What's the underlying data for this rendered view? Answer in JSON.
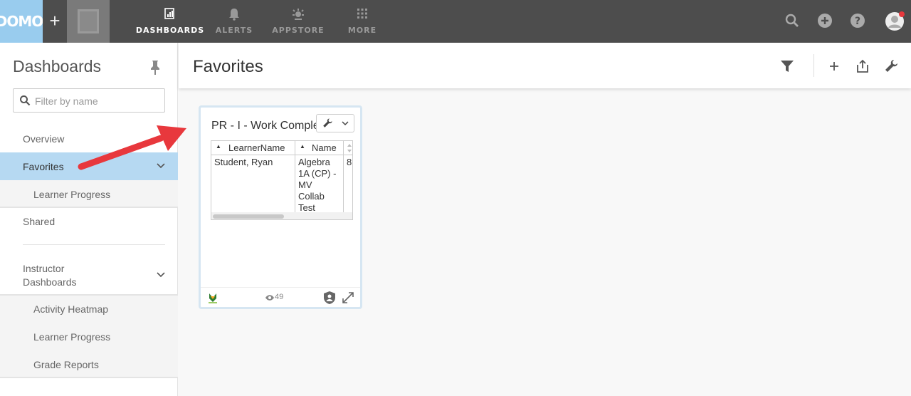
{
  "topnav": {
    "logo": "DOMO",
    "add": "+",
    "items": [
      {
        "label": "DASHBOARDS",
        "icon": "dashboards-icon",
        "active": true
      },
      {
        "label": "ALERTS",
        "icon": "bell-icon",
        "active": false
      },
      {
        "label": "APPSTORE",
        "icon": "appstore-icon",
        "active": false
      },
      {
        "label": "MORE",
        "icon": "grid-icon",
        "active": false
      }
    ],
    "right_icons": [
      "search-icon",
      "add-circle-icon",
      "help-icon",
      "user-avatar-icon"
    ]
  },
  "sidebar": {
    "title": "Dashboards",
    "filter_placeholder": "Filter by name",
    "items": [
      {
        "label": "Overview"
      },
      {
        "label": "Favorites",
        "active": true
      },
      {
        "label": "Learner Progress"
      },
      {
        "label": "Shared"
      },
      {
        "label": "Instructor Dashboards"
      },
      {
        "label": "Activity Heatmap"
      },
      {
        "label": "Learner Progress"
      },
      {
        "label": "Grade Reports"
      }
    ],
    "instructor_line1": "Instructor",
    "instructor_line2": "Dashboards"
  },
  "main": {
    "title": "Favorites",
    "card": {
      "title": "PR - I - Work Completion",
      "columns": [
        "LearnerName",
        "Name",
        ""
      ],
      "row": {
        "learner": "Student, Ryan",
        "name_lines": [
          "Algebra",
          "1A (CP) -",
          "MV",
          "Collab",
          "Test"
        ],
        "third": "8"
      },
      "views": "49"
    }
  },
  "colors": {
    "nav_bg": "#4d4d4d",
    "logo_bg": "#99ccee",
    "active_item": "#b6d9f2",
    "annotation_arrow": "#e8383d"
  }
}
